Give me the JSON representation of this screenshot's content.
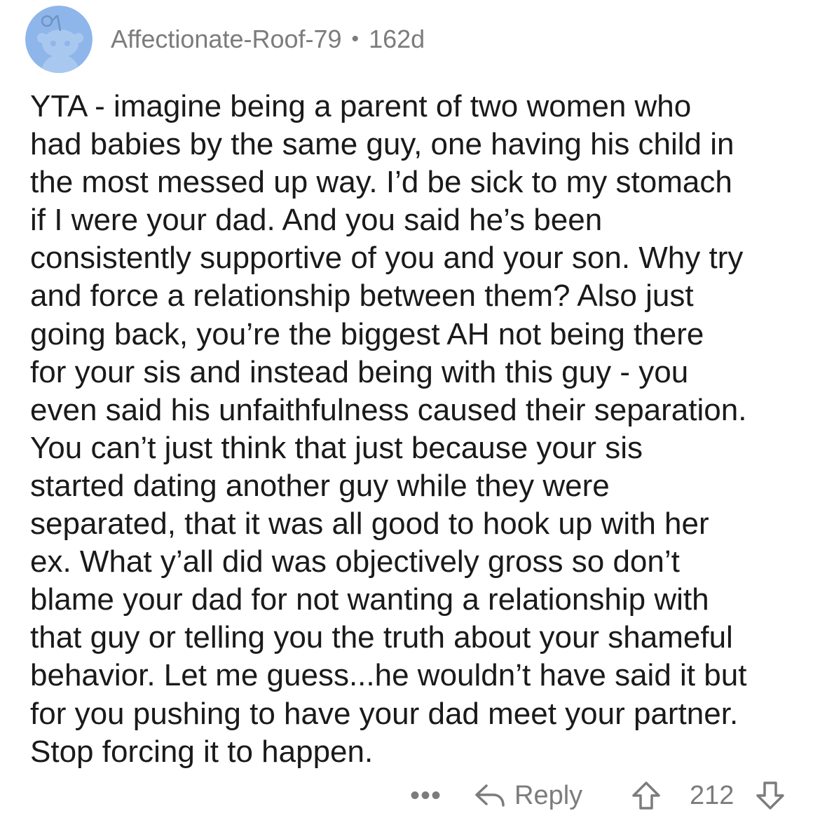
{
  "comment": {
    "username": "Affectionate-Roof-79",
    "separator": "•",
    "age": "162d",
    "body": "YTA - imagine being a parent of two women who\nhad babies by the same guy, one having his child in\nthe most messed up way. I’d be sick to my stomach\nif I were your dad. And you said he’s been\nconsistently supportive of you and your son. Why try\nand force a relationship between them? Also just\ngoing back, you’re the biggest AH not being there\nfor your sis and instead being with this guy - you\neven said his unfaithfulness caused their separation.\nYou can’t just think that just because your sis\nstarted dating another guy while they were\nseparated, that it was all good to hook up with her\nex. What y’all did was objectively gross so don’t\nblame your dad for not wanting a relationship with\nthat guy or telling you the truth about your shameful\nbehavior. Let me guess...he wouldn’t have said it but\nfor you pushing to have your dad meet your partner.\nStop forcing it to happen.",
    "avatar_icon": "reddit-snoo-avatar-icon"
  },
  "actions": {
    "more": "•••",
    "reply_label": "Reply",
    "score": "212"
  },
  "colors": {
    "avatar_bg": "#8fb6ea",
    "avatar_figure": "#a9c8f0",
    "meta_text": "#7c7c7c",
    "body_text": "#1a1a1b"
  }
}
